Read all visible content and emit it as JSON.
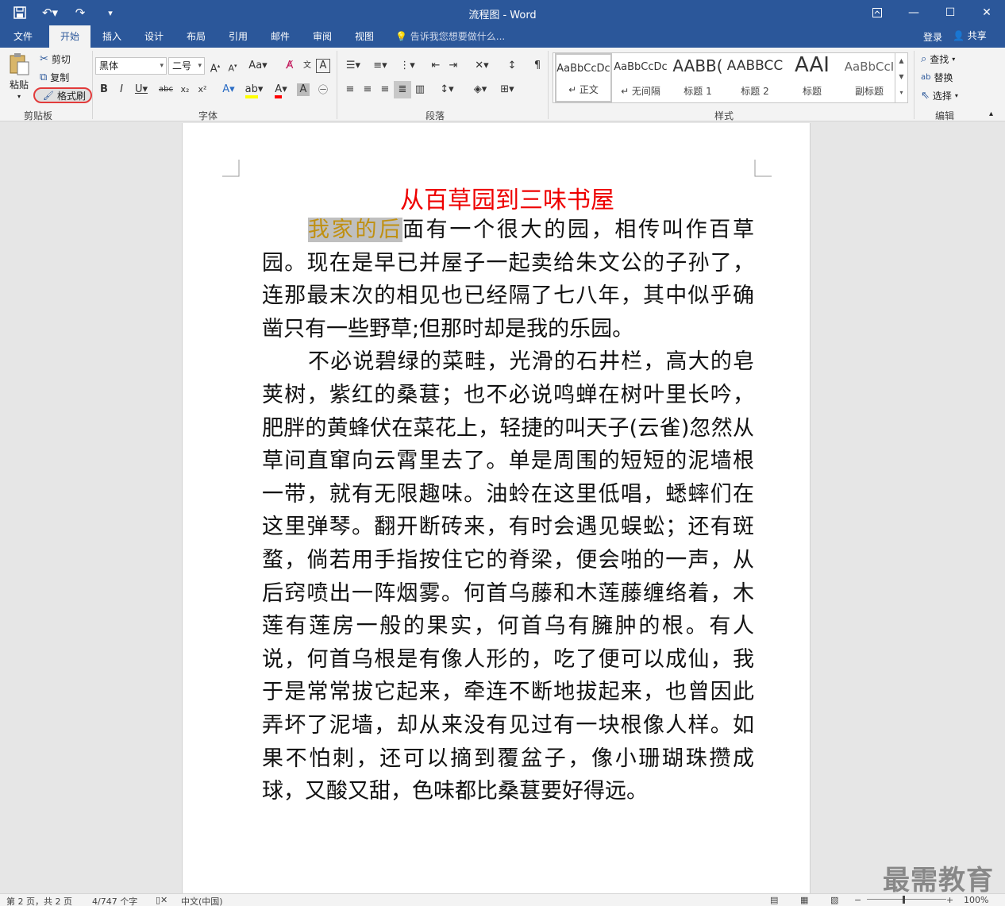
{
  "window": {
    "title": "流程图 - Word"
  },
  "qat": {
    "save_icon": "save-icon",
    "undo_icon": "undo-icon",
    "redo_icon": "redo-icon",
    "customize_icon": "customize-qat-icon"
  },
  "tabs": [
    {
      "label": "文件"
    },
    {
      "label": "开始"
    },
    {
      "label": "插入"
    },
    {
      "label": "设计"
    },
    {
      "label": "布局"
    },
    {
      "label": "引用"
    },
    {
      "label": "邮件"
    },
    {
      "label": "审阅"
    },
    {
      "label": "视图"
    }
  ],
  "tellme": "告诉我您想要做什么...",
  "account": {
    "login": "登录",
    "share": "共享"
  },
  "clipboard": {
    "paste": "粘贴",
    "cut": "剪切",
    "copy": "复制",
    "format_painter": "格式刷",
    "group": "剪贴板"
  },
  "font": {
    "name": "黑体",
    "size": "二号",
    "group": "字体"
  },
  "paragraph": {
    "group": "段落"
  },
  "styles": {
    "items": [
      {
        "preview": "AaBbCcDc",
        "name": "↵ 正文"
      },
      {
        "preview": "AaBbCcDc",
        "name": "↵ 无间隔"
      },
      {
        "preview": "AABB(",
        "name": "标题 1"
      },
      {
        "preview": "AABBCC",
        "name": "标题 2"
      },
      {
        "preview": "AAI",
        "name": "标题"
      },
      {
        "preview": "AaBbCcI",
        "name": "副标题"
      }
    ],
    "group": "样式"
  },
  "editing": {
    "find": "查找",
    "replace": "替换",
    "select": "选择",
    "group": "编辑"
  },
  "document": {
    "heading": "从百草园到三味书屋",
    "highlight": "我家的后",
    "para1_rest": "面有一个很大的园，相传叫作百草园。现在是早已并屋子一起卖给朱文公的子孙了，连那最末次的相见也已经隔了七八年，其中似乎确凿只有一些野草;但那时却是我的乐园。",
    "para2": "不必说碧绿的菜畦，光滑的石井栏，高大的皂荚树，紫红的桑葚；也不必说鸣蝉在树叶里长吟，肥胖的黄蜂伏在菜花上，轻捷的叫天子(云雀)忽然从草间直窜向云霄里去了。单是周围的短短的泥墙根一带，就有无限趣味。油蛉在这里低唱，蟋蟀们在这里弹琴。翻开断砖来，有时会遇见蜈蚣；还有斑蝥，倘若用手指按住它的脊梁，便会啪的一声，从后窍喷出一阵烟雾。何首乌藤和木莲藤缠络着，木莲有莲房一般的果实，何首乌有臃肿的根。有人说，何首乌根是有像人形的，吃了便可以成仙，我于是常常拔它起来，牵连不断地拔起来，也曾因此弄坏了泥墙，却从来没有见过有一块根像人样。如果不怕刺，还可以摘到覆盆子，像小珊瑚珠攒成球，又酸又甜，色味都比桑葚要好得远。"
  },
  "status": {
    "page": "第 2 页，共 2 页",
    "words": "4/747 个字",
    "lang": "中文(中国)",
    "zoom": "100%"
  },
  "watermark": "最需教育"
}
